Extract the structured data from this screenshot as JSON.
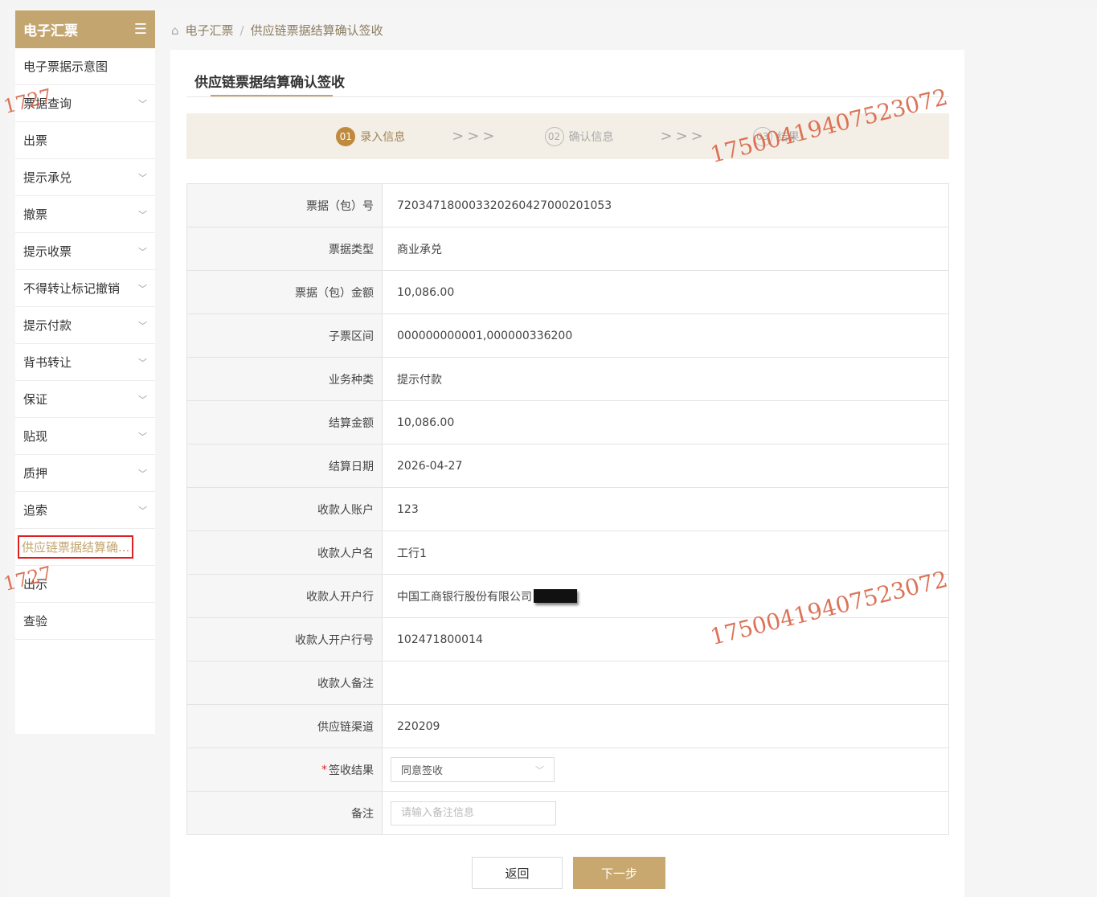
{
  "sidebar": {
    "title": "电子汇票",
    "items": [
      {
        "label": "电子票据示意图",
        "has_chevron": false
      },
      {
        "label": "票据查询",
        "has_chevron": true
      },
      {
        "label": "出票",
        "has_chevron": false
      },
      {
        "label": "提示承兑",
        "has_chevron": true
      },
      {
        "label": "撤票",
        "has_chevron": true
      },
      {
        "label": "提示收票",
        "has_chevron": true
      },
      {
        "label": "不得转让标记撤销",
        "has_chevron": true
      },
      {
        "label": "提示付款",
        "has_chevron": true
      },
      {
        "label": "背书转让",
        "has_chevron": true
      },
      {
        "label": "保证",
        "has_chevron": true
      },
      {
        "label": "贴现",
        "has_chevron": true
      },
      {
        "label": "质押",
        "has_chevron": true
      },
      {
        "label": "追索",
        "has_chevron": true
      },
      {
        "label": "供应链票据结算确...",
        "has_chevron": false,
        "active": true
      },
      {
        "label": "出示",
        "has_chevron": false
      },
      {
        "label": "查验",
        "has_chevron": false
      }
    ]
  },
  "breadcrumb": {
    "home": "电子汇票",
    "sep": "/",
    "current": "供应链票据结算确认签收"
  },
  "page_title": "供应链票据结算确认签收",
  "steps": [
    {
      "num": "01",
      "label": "录入信息",
      "active": true
    },
    {
      "num": "02",
      "label": "确认信息",
      "active": false
    },
    {
      "num": "03",
      "label": "结果",
      "active": false
    }
  ],
  "step_arrows": ">>>",
  "form": {
    "rows": [
      {
        "label": "票据（包）号",
        "value": "720347180003320260427000201053"
      },
      {
        "label": "票据类型",
        "value": "商业承兑"
      },
      {
        "label": "票据（包）金额",
        "value": "10,086.00"
      },
      {
        "label": "子票区间",
        "value": "000000000001,000000336200"
      },
      {
        "label": "业务种类",
        "value": "提示付款"
      },
      {
        "label": "结算金额",
        "value": "10,086.00"
      },
      {
        "label": "结算日期",
        "value": "2026-04-27"
      },
      {
        "label": "收款人账户",
        "value": "123"
      },
      {
        "label": "收款人户名",
        "value": "工行1"
      },
      {
        "label": "收款人开户行",
        "value": "中国工商银行股份有限公司"
      },
      {
        "label": "收款人开户行号",
        "value": "102471800014"
      },
      {
        "label": "收款人备注",
        "value": ""
      },
      {
        "label": "供应链渠道",
        "value": "220209"
      }
    ],
    "sign_result_label": "签收结果",
    "sign_result_required_mark": "*",
    "sign_result_value": "同意签收",
    "remark_label": "备注",
    "remark_placeholder": "请输入备注信息"
  },
  "buttons": {
    "back": "返回",
    "next": "下一步"
  },
  "watermarks": {
    "text": "17500419407523072",
    "top_right": "17500419407523072",
    "mid_right": "17500419407523072",
    "left_frag_1": "1727",
    "left_frag_2": "1727"
  },
  "colors": {
    "accent": "#c3a56f",
    "active_step": "#c08a3e",
    "highlight_border": "#e02020"
  }
}
